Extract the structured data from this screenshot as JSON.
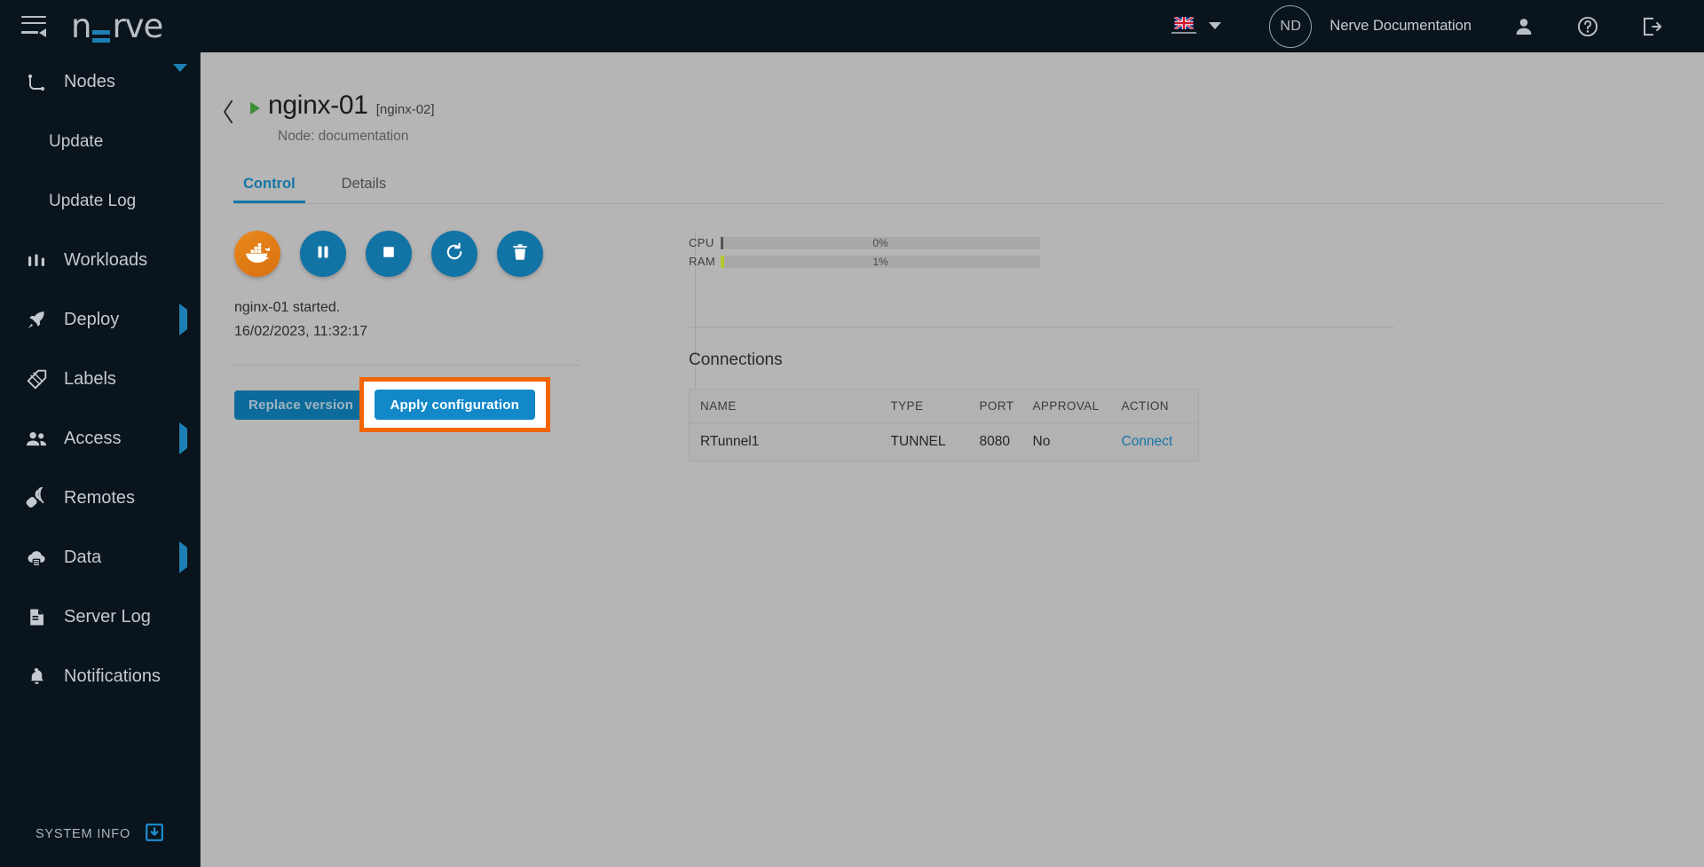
{
  "topbar": {
    "brand_left": "n",
    "brand_right": "rve",
    "menu_icon": "hamburger-collapse-icon",
    "language_flag": "uk-flag-icon",
    "avatar_initials": "ND",
    "username": "Nerve Documentation",
    "user_icon": "person-icon",
    "help_icon": "question-mark-icon",
    "logout_icon": "logout-icon"
  },
  "sidebar": {
    "items": [
      {
        "label": "Nodes",
        "icon": "nodes-icon",
        "expander": "down",
        "sub": false
      },
      {
        "label": "Update",
        "icon": "",
        "expander": "",
        "sub": true
      },
      {
        "label": "Update Log",
        "icon": "",
        "expander": "",
        "sub": true
      },
      {
        "label": "Workloads",
        "icon": "workloads-icon",
        "expander": "",
        "sub": false
      },
      {
        "label": "Deploy",
        "icon": "rocket-icon",
        "expander": "right",
        "sub": false
      },
      {
        "label": "Labels",
        "icon": "label-tag-icon",
        "expander": "",
        "sub": false
      },
      {
        "label": "Access",
        "icon": "users-icon",
        "expander": "right",
        "sub": false
      },
      {
        "label": "Remotes",
        "icon": "remote-control-icon",
        "expander": "",
        "sub": false
      },
      {
        "label": "Data",
        "icon": "cloud-data-icon",
        "expander": "right",
        "sub": false
      },
      {
        "label": "Server Log",
        "icon": "document-icon",
        "expander": "",
        "sub": false
      },
      {
        "label": "Notifications",
        "icon": "bell-icon",
        "expander": "",
        "sub": false
      }
    ],
    "system_info_label": "SYSTEM INFO",
    "system_info_icon": "download-box-icon"
  },
  "page": {
    "back_icon": "chevron-left-icon",
    "status_icon": "play-triangle-icon",
    "title": "nginx-01",
    "title_id": "[nginx-02]",
    "node_line": "Node: documentation"
  },
  "tabs": [
    {
      "label": "Control",
      "active": true
    },
    {
      "label": "Details",
      "active": false
    }
  ],
  "control": {
    "buttons": [
      {
        "name": "docker-logo-button",
        "icon": "docker-whale-icon"
      },
      {
        "name": "pause-button",
        "icon": "pause-icon"
      },
      {
        "name": "stop-button",
        "icon": "stop-square-icon"
      },
      {
        "name": "restart-button",
        "icon": "restart-circular-arrow-icon"
      },
      {
        "name": "delete-button",
        "icon": "trash-can-icon"
      }
    ],
    "status_text": "nginx-01 started.",
    "status_timestamp": "16/02/2023, 11:32:17",
    "replace_version_label": "Replace version",
    "apply_configuration_label": "Apply configuration",
    "highlight_color": "#f26500"
  },
  "metrics": [
    {
      "label": "CPU",
      "percent_text": "0%",
      "value": 0,
      "color": "#555555"
    },
    {
      "label": "RAM",
      "percent_text": "1%",
      "value": 1,
      "color": "#b5c92e"
    }
  ],
  "connections": {
    "title": "Connections",
    "columns": [
      "NAME",
      "TYPE",
      "PORT",
      "APPROVAL",
      "ACTION"
    ],
    "rows": [
      {
        "name": "RTunnel1",
        "type": "TUNNEL",
        "port": "8080",
        "approval": "No",
        "action": "Connect"
      }
    ]
  },
  "colors": {
    "sidebar_bg": "#0a141c",
    "main_bg": "#b5b5b5",
    "accent_blue": "#1476a8",
    "brand_blue": "#1d7fb3",
    "button_blue": "#1288c9",
    "highlight_orange": "#f26500",
    "docker_orange": "#dd7312",
    "running_green": "#3c8c33"
  }
}
